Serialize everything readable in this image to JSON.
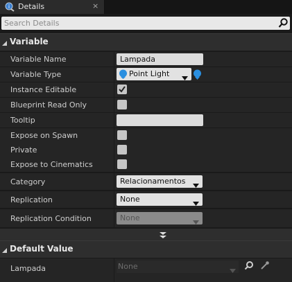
{
  "window": {
    "tab_title": "Details",
    "tab_close": "×"
  },
  "search": {
    "placeholder": "Search Details"
  },
  "variable_section": {
    "title": "Variable",
    "rows": {
      "name": {
        "label": "Variable Name",
        "value": "Lampada"
      },
      "type": {
        "label": "Variable Type",
        "value": "Point Light"
      },
      "instance_editable": {
        "label": "Instance Editable",
        "checked": true
      },
      "blueprint_read_only": {
        "label": "Blueprint Read Only",
        "checked": false
      },
      "tooltip": {
        "label": "Tooltip",
        "value": ""
      },
      "expose_on_spawn": {
        "label": "Expose on Spawn",
        "checked": false
      },
      "private": {
        "label": "Private",
        "checked": false
      },
      "expose_to_cinematics": {
        "label": "Expose to Cinematics",
        "checked": false
      },
      "category": {
        "label": "Category",
        "value": "Relacionamentos"
      },
      "replication": {
        "label": "Replication",
        "value": "None"
      },
      "replication_condition": {
        "label": "Replication Condition",
        "value": "None"
      }
    }
  },
  "default_value_section": {
    "title": "Default Value",
    "rows": {
      "lampada": {
        "label": "Lampada",
        "value": "None"
      }
    }
  },
  "colors": {
    "accent_blue": "#2a8fe0",
    "panel": "#252525",
    "header": "#2e2e2e"
  }
}
